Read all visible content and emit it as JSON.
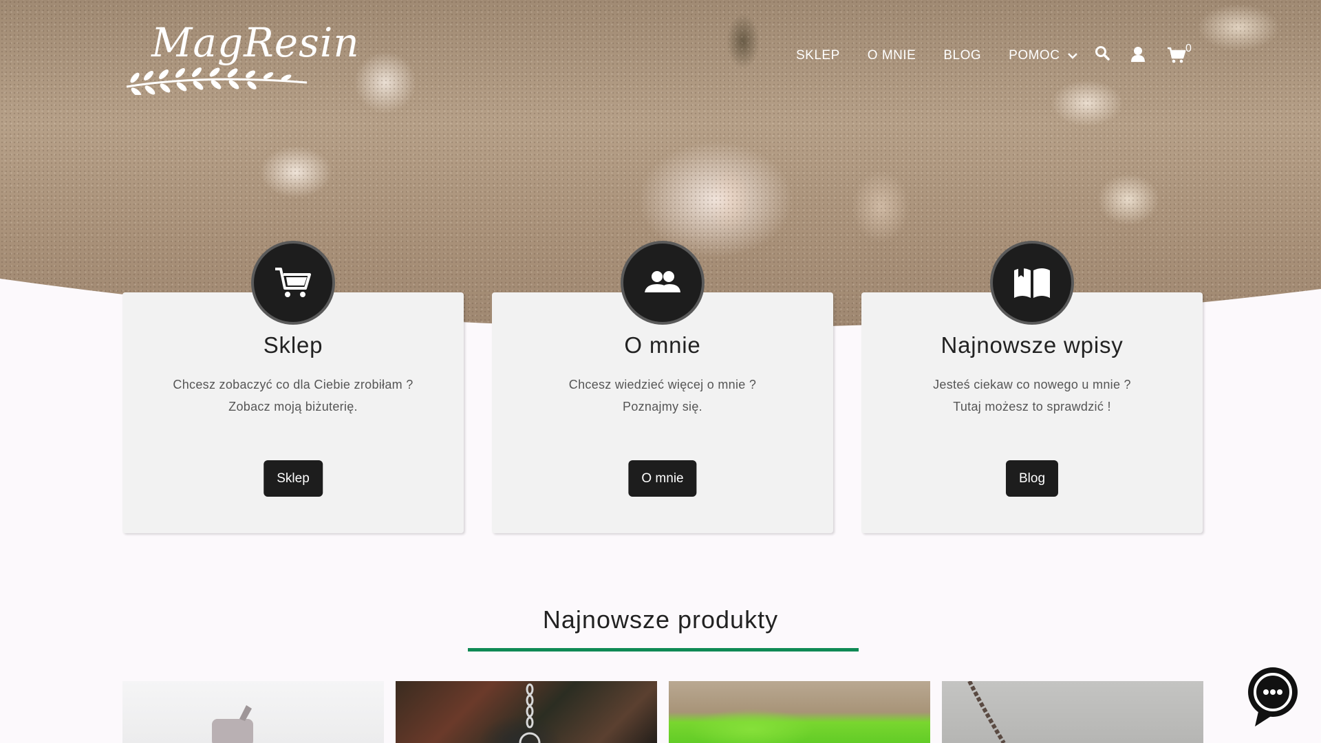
{
  "brand": {
    "logo_text": "MagResin"
  },
  "nav": {
    "items": [
      {
        "label": "SKLEP"
      },
      {
        "label": "O MNIE"
      },
      {
        "label": "BLOG"
      },
      {
        "label": "POMOC"
      }
    ],
    "cart_count": "0"
  },
  "cards": [
    {
      "icon": "shopping-cart-icon",
      "title": "Sklep",
      "line1": "Chcesz zobaczyć co dla Ciebie zrobiłam ?",
      "line2": "Zobacz moją biżuterię.",
      "button": "Sklep"
    },
    {
      "icon": "users-icon",
      "title": "O mnie",
      "line1": "Chcesz wiedzieć więcej o mnie ?",
      "line2": "Poznajmy się.",
      "button": "O mnie"
    },
    {
      "icon": "open-book-icon",
      "title": "Najnowsze wpisy",
      "line1": "Jesteś ciekaw co nowego u mnie ?",
      "line2": "Tutaj możesz to sprawdzić !",
      "button": "Blog"
    }
  ],
  "products_section": {
    "title": "Najnowsze produkty"
  },
  "colors": {
    "accent_line": "#0f8a55",
    "dark": "#1d1d1d",
    "card_bg": "#f2f2f2"
  }
}
